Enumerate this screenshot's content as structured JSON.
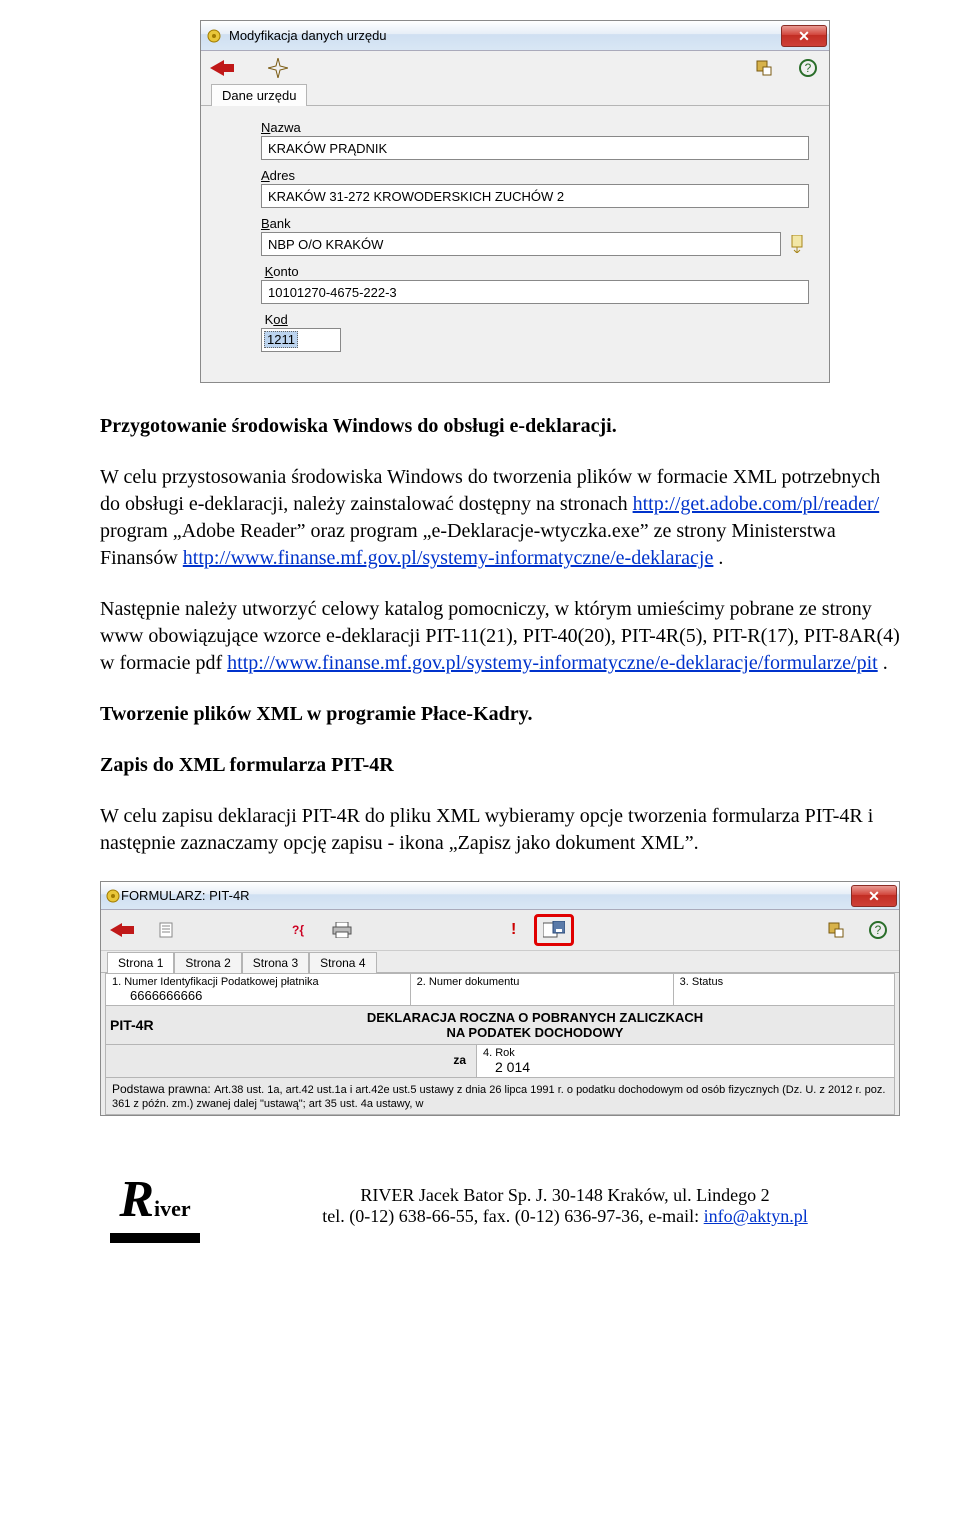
{
  "dialog1": {
    "title": "Modyfikacja danych urzędu",
    "tab_label": "Dane urzędu",
    "fields": {
      "nazwa_label_pre": "N",
      "nazwa_label_post": "azwa",
      "nazwa_value": "KRAKÓW PRĄDNIK",
      "adres_label_pre": "A",
      "adres_label_post": "dres",
      "adres_value": "KRAKÓW 31-272 KROWODERSKICH ZUCHÓW 2",
      "bank_label_pre": "B",
      "bank_label_post": "ank",
      "bank_value": "NBP O/O KRAKÓW",
      "konto_label_pre": "K",
      "konto_label_post": "onto",
      "konto_value": "10101270-4675-222-3",
      "kod_label_pre": "K",
      "kod_label_post": "od",
      "kod_value": "1211"
    }
  },
  "doc": {
    "h1": "Przygotowanie środowiska Windows do  obsługi e-deklaracji.",
    "p1_a": "W celu przystosowania środowiska Windows do tworzenia plików w formacie XML potrzebnych do obsługi e-deklaracji, należy zainstalować dostępny na stronach ",
    "p1_link1": "http://get.adobe.com/pl/reader/",
    "p1_b": " program „Adobe Reader” oraz program „e-Deklaracje-wtyczka.exe” ze strony Ministerstwa Finansów ",
    "p1_link2": "http://www.finanse.mf.gov.pl/systemy-informatyczne/e-deklaracje",
    "p1_c": " .",
    "p2_a": "Następnie należy utworzyć celowy katalog pomocniczy, w którym umieścimy pobrane ze strony www obowiązujące wzorce e-deklaracji  PIT-11(21), PIT-40(20), PIT-4R(5), PIT-R(17), PIT-8AR(4) w formacie pdf  ",
    "p2_link": "http://www.finanse.mf.gov.pl/systemy-informatyczne/e-deklaracje/formularze/pit",
    "p2_b": " .",
    "h2": "Tworzenie plików XML w programie Płace-Kadry.",
    "h3": "Zapis do XML formularza PIT-4R",
    "p3": "W celu zapisu deklaracji PIT-4R do pliku XML wybieramy opcje tworzenia formularza PIT-4R i następnie zaznaczamy opcję zapisu - ikona „Zapisz jako dokument XML”."
  },
  "dialog2": {
    "title": "FORMULARZ:   PIT-4R",
    "tabs": [
      "Strona 1",
      "Strona 2",
      "Strona 3",
      "Strona 4"
    ],
    "row1": {
      "c1_label": "1. Numer Identyfikacji Podatkowej płatnika",
      "c1_value": "6666666666",
      "c2_label": "2. Numer dokumentu",
      "c3_label": "3. Status"
    },
    "decl": {
      "left": "PIT-4R",
      "line1": "DEKLARACJA ROCZNA O POBRANYCH ZALICZKACH",
      "line2": "NA PODATEK DOCHODOWY"
    },
    "za": {
      "label": "za",
      "box_label": "4. Rok",
      "box_value": "2 014"
    },
    "podst_label": "Podstawa prawna:",
    "podst_text": "Art.38 ust. 1a, art.42 ust.1a i art.42e ust.5 ustawy z dnia 26 lipca 1991 r. o podatku dochodowym od osób fizycznych (Dz. U. z 2012 r. poz. 361 z późn. zm.) zwanej dalej \"ustawą\"; art 35 ust. 4a ustawy, w"
  },
  "footer": {
    "line1": "RIVER Jacek Bator Sp. J. 30-148 Kraków, ul. Lindego 2",
    "line2_a": "tel. (0-12) 638-66-55, fax. (0-12) 636-97-36, e-mail: ",
    "line2_link": "info@aktyn.pl",
    "logo_top": "R",
    "logo_rest": "iver"
  }
}
